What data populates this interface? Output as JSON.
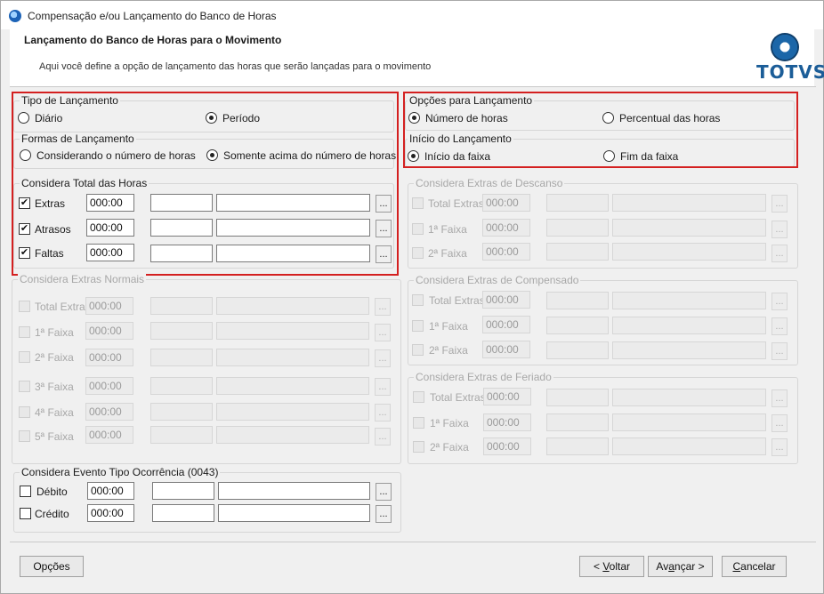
{
  "window": {
    "title": "Compensação e/ou Lançamento do Banco de Horas"
  },
  "header": {
    "title": "Lançamento do Banco de Horas para o Movimento",
    "description": "Aqui você define a opção de lançamento das horas que serão lançadas para o movimento",
    "logo_text": "TOTVS"
  },
  "tipo_lancamento": {
    "legend": "Tipo de Lançamento",
    "options": [
      "Diário",
      "Período"
    ],
    "selected": "Período"
  },
  "formas_lancamento": {
    "legend": "Formas de Lançamento",
    "options": [
      "Considerando o número de horas",
      "Somente acima do número de horas"
    ],
    "selected": "Somente acima do número de horas"
  },
  "considera_total": {
    "legend": "Considera Total das Horas",
    "rows": [
      {
        "label": "Extras",
        "checked": true,
        "value": "000:00"
      },
      {
        "label": "Atrasos",
        "checked": true,
        "value": "000:00"
      },
      {
        "label": "Faltas",
        "checked": true,
        "value": "000:00"
      }
    ]
  },
  "extras_normais": {
    "legend": "Considera Extras Normais",
    "rows": [
      {
        "label": "Total Extras",
        "value": "000:00"
      },
      {
        "label": "1ª Faixa",
        "value": "000:00"
      },
      {
        "label": "2ª Faixa",
        "value": "000:00"
      },
      {
        "label": "3ª Faixa",
        "value": "000:00"
      },
      {
        "label": "4ª Faixa",
        "value": "000:00"
      },
      {
        "label": "5ª Faixa",
        "value": "000:00"
      }
    ]
  },
  "evento_ocorrencia": {
    "legend": "Considera Evento Tipo Ocorrência (0043)",
    "rows": [
      {
        "label": "Débito",
        "value": "000:00"
      },
      {
        "label": "Crédito",
        "value": "000:00"
      }
    ]
  },
  "opcoes_lancamento": {
    "legend": "Opções para Lançamento",
    "options": [
      "Número de horas",
      "Percentual das horas"
    ],
    "selected": "Número de horas"
  },
  "inicio_lancamento": {
    "legend": "Início do Lançamento",
    "options": [
      "Início da faixa",
      "Fim da faixa"
    ],
    "selected": "Início da faixa"
  },
  "extras_descanso": {
    "legend": "Considera Extras de Descanso",
    "rows": [
      {
        "label": "Total Extras",
        "value": "000:00"
      },
      {
        "label": "1ª Faixa",
        "value": "000:00"
      },
      {
        "label": "2ª Faixa",
        "value": "000:00"
      }
    ]
  },
  "extras_compensado": {
    "legend": "Considera Extras de Compensado",
    "rows": [
      {
        "label": "Total Extras",
        "value": "000:00"
      },
      {
        "label": "1ª Faixa",
        "value": "000:00"
      },
      {
        "label": "2ª Faixa",
        "value": "000:00"
      }
    ]
  },
  "extras_feriado": {
    "legend": "Considera Extras de Feriado",
    "rows": [
      {
        "label": "Total Extras",
        "value": "000:00"
      },
      {
        "label": "1ª Faixa",
        "value": "000:00"
      },
      {
        "label": "2ª Faixa",
        "value": "000:00"
      }
    ]
  },
  "buttons": {
    "ellipsis": "...",
    "opcoes": "Opções",
    "voltar_prefix": "< ",
    "voltar_key": "V",
    "voltar_rest": "oltar",
    "avancar_prefix": "Av",
    "avancar_key": "a",
    "avancar_rest": "nçar >",
    "cancelar_key": "C",
    "cancelar_rest": "ancelar"
  },
  "colors": {
    "highlight": "#d42020",
    "logo": "#1b5d98",
    "dialog_bg": "#f0f0f0"
  }
}
